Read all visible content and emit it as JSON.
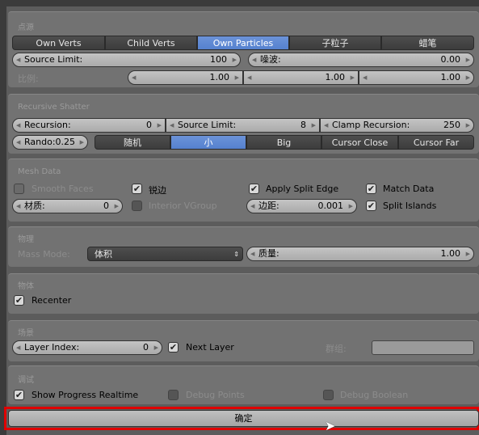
{
  "source": {
    "header": "点源",
    "tabs": [
      {
        "label": "Own Verts",
        "active": false
      },
      {
        "label": "Child Verts",
        "active": false
      },
      {
        "label": "Own Particles",
        "active": true
      },
      {
        "label": "子粒子",
        "active": false
      },
      {
        "label": "蜡笔",
        "active": false
      }
    ],
    "source_limit_label": "Source Limit:",
    "source_limit": "100",
    "noise_label": "噪波:",
    "noise": "0.00",
    "scale_label": "比例:",
    "scale": [
      "1.00",
      "1.00",
      "1.00"
    ]
  },
  "recursive": {
    "header": "Recursive Shatter",
    "recursion_label": "Recursion:",
    "recursion": "0",
    "source_limit_label": "Source Limit:",
    "source_limit": "8",
    "clamp_label": "Clamp Recursion:",
    "clamp": "250",
    "rando_label": "Rando:",
    "rando": "0.25",
    "modes": [
      {
        "label": "随机",
        "active": false
      },
      {
        "label": "小",
        "active": true
      },
      {
        "label": "Big",
        "active": false
      },
      {
        "label": "Cursor Close",
        "active": false
      },
      {
        "label": "Cursor Far",
        "active": false
      }
    ]
  },
  "mesh": {
    "header": "Mesh Data",
    "smooth_faces": "Smooth Faces",
    "sharp_edges": "锐边",
    "apply_split_edge": "Apply Split Edge",
    "match_data": "Match Data",
    "material_label": "材质:",
    "material": "0",
    "interior_vgroup": "Interior VGroup",
    "margin_label": "边距:",
    "margin": "0.001",
    "split_islands": "Split Islands"
  },
  "physics": {
    "header": "物理",
    "mass_mode_label": "Mass Mode:",
    "mass_mode": "体积",
    "mass_label": "质量:",
    "mass": "1.00"
  },
  "object": {
    "header": "物体",
    "recenter": "Recenter"
  },
  "scene": {
    "header": "场景",
    "layer_index_label": "Layer Index:",
    "layer_index": "0",
    "next_layer": "Next Layer",
    "group_label": "群组:",
    "group": ""
  },
  "debug": {
    "header": "调试",
    "show_progress": "Show Progress Realtime",
    "debug_points": "Debug Points",
    "debug_boolean": "Debug Boolean"
  },
  "confirm": "确定",
  "colors": {
    "accent": "#5680d0",
    "highlight": "#e00000"
  }
}
